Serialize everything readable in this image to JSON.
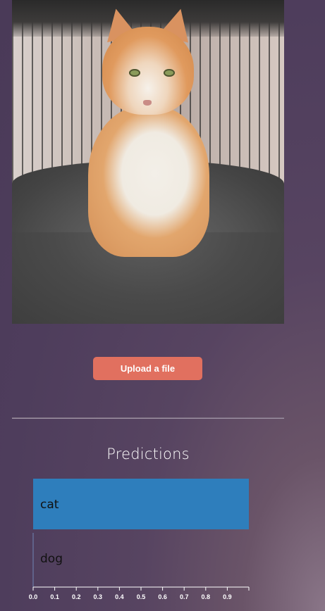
{
  "upload": {
    "label": "Upload a file"
  },
  "predictions": {
    "title": "Predictions"
  },
  "colors": {
    "bar": "#2e7ebc",
    "button": "#e1705f"
  },
  "chart_data": {
    "type": "bar",
    "orientation": "horizontal",
    "categories": [
      "cat",
      "dog"
    ],
    "values": [
      1.0,
      0.0
    ],
    "xlim": [
      0,
      1.0
    ],
    "xticks": [
      "0.0",
      "0.1",
      "0.2",
      "0.3",
      "0.4",
      "0.5",
      "0.6",
      "0.7",
      "0.8",
      "0.9"
    ],
    "title": "Predictions",
    "xlabel": "",
    "ylabel": ""
  }
}
